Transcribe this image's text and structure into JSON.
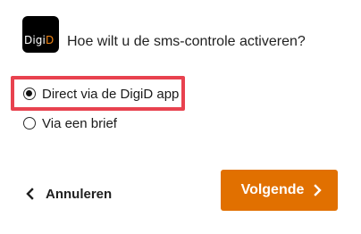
{
  "logo": {
    "text_main": "Digi",
    "text_accent": "D",
    "accent_color": "#f18515",
    "icon": "digid-logo"
  },
  "question": "Hoe wilt u de sms-controle activeren?",
  "options": [
    {
      "label": "Direct via de DigiD app",
      "selected": true
    },
    {
      "label": "Via een brief",
      "selected": false
    }
  ],
  "actions": {
    "cancel_label": "Annuleren",
    "cancel_icon": "chevron-left-icon",
    "next_label": "Volgende",
    "next_icon": "chevron-right-icon",
    "next_color": "#e17000"
  },
  "highlight_color": "#e8424f"
}
